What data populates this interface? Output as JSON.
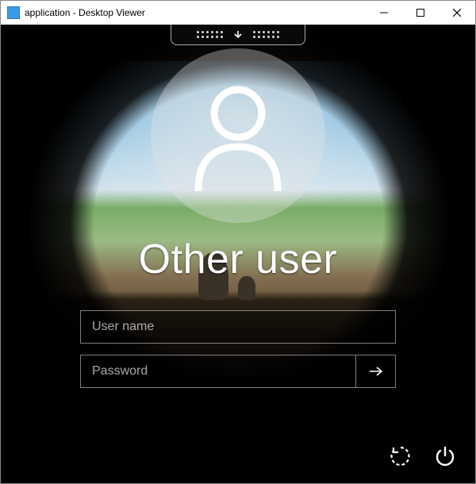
{
  "window": {
    "title": "application - Desktop Viewer"
  },
  "login": {
    "account_label": "Other user",
    "username_placeholder": "User name",
    "password_placeholder": "Password",
    "username_value": "",
    "password_value": ""
  }
}
